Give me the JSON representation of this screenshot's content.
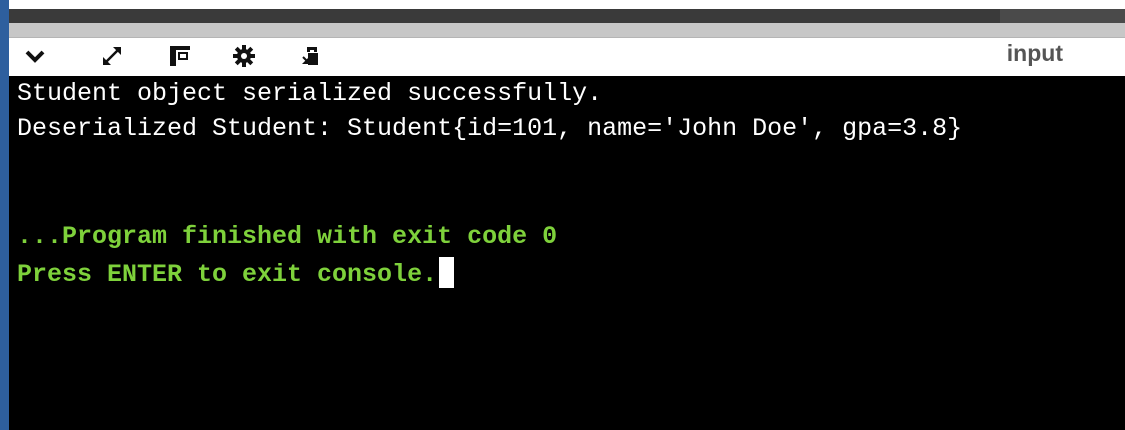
{
  "toolbar": {
    "icons": [
      "chevron-down-icon",
      "expand-icon",
      "layout-icon",
      "gear-icon",
      "debug-icon"
    ],
    "input_tab_label": "input"
  },
  "console": {
    "lines": [
      "Student object serialized successfully.",
      "Deserialized Student: Student{id=101, name='John Doe', gpa=3.8}",
      "",
      "",
      "...Program finished with exit code 0",
      "Press ENTER to exit console."
    ]
  },
  "colors": {
    "console_background": "#000000",
    "program_output": "#ffffff",
    "system_message": "#7ed13b",
    "accent_edge": "#2e5f9e"
  }
}
